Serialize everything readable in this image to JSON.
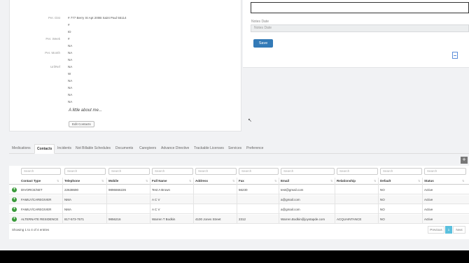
{
  "profile": {
    "rows": [
      {
        "label": "Per. Dist",
        "value": "# 777 Berry St Apt 200B Saint Paul 55114"
      },
      {
        "label": "",
        "value": "#"
      },
      {
        "label": "",
        "value": "ID"
      },
      {
        "label": "Per. Week",
        "value": "#"
      },
      {
        "label": "",
        "value": "NA"
      },
      {
        "label": "Per. Month",
        "value": "NA"
      },
      {
        "label": "",
        "value": "NA"
      },
      {
        "label": "Url/Ref",
        "value": "NA"
      },
      {
        "label": "",
        "value": "W"
      },
      {
        "label": "",
        "value": "NA"
      },
      {
        "label": "",
        "value": "NA"
      },
      {
        "label": "",
        "value": "NA"
      },
      {
        "label": "",
        "value": "NA"
      },
      {
        "label": "",
        "value": "IN"
      }
    ],
    "about": "A little about me...",
    "edit_label": "Edit Contacts"
  },
  "notes": {
    "label": "Notes Date",
    "placeholder": "Notes Date",
    "save_label": "Save"
  },
  "tabs": [
    {
      "label": "Medications"
    },
    {
      "label": "Contacts"
    },
    {
      "label": "Incidents"
    },
    {
      "label": "Not Billable Schedules"
    },
    {
      "label": "Documents"
    },
    {
      "label": "Caregivers"
    },
    {
      "label": "Advance Directive"
    },
    {
      "label": "Trackable Licenses"
    },
    {
      "label": "Services"
    },
    {
      "label": "Preference"
    }
  ],
  "table": {
    "search_placeholder": "Search",
    "columns": [
      "Contact Type",
      "Telephone",
      "Mobile",
      "Full Name",
      "Address",
      "Fax",
      "Email",
      "Relationship",
      "Default",
      "Status"
    ],
    "rows": [
      [
        "DIVORCE/SET",
        "22638690",
        "9896666226",
        "Test A Brown",
        "",
        "56230",
        "test@gmail.com",
        "",
        "NO",
        "Active"
      ],
      [
        "FAMILY/CAREGIVER",
        "NMA",
        "",
        "A C V",
        "",
        "",
        "a@gmail.com",
        "",
        "NO",
        "Active"
      ],
      [
        "FAMILY/CAREGIVER",
        "NMA",
        "",
        "A C V",
        "",
        "",
        "a@gmail.com",
        "",
        "NO",
        "Active"
      ],
      [
        "ALTERNATE RESIDENCE",
        "817-573-7571",
        "9856216",
        "Warren T Bodkin",
        "4100 Jones Street",
        "2312",
        "Warren.Bodkin@joystapde.com",
        "ACQUAINTANCE",
        "NO",
        "Active"
      ]
    ],
    "footer": "Showing 1 to 4 of 4 entries",
    "pager": {
      "prev": "Previous",
      "page": "1",
      "next": "Next"
    }
  }
}
